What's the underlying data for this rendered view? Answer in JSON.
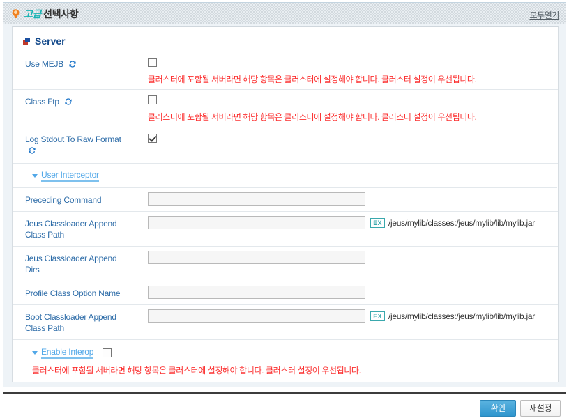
{
  "header": {
    "icon": "bulb-icon",
    "title_accent": "고급",
    "title_main": "선택사항",
    "open_all_label": "모두열기"
  },
  "section": {
    "icon": "blue-red-square-icon",
    "title": "Server"
  },
  "warnings": {
    "cluster_notice": "클러스터에 포함될 서버라면 해당 항목은 클러스터에 설정해야 합니다. 클러스터 설정이 우선됩니다."
  },
  "checkbox_rows": [
    {
      "label": "Use MEJB",
      "has_sync_icon": true,
      "checked": false,
      "warning": "클러스터에 포함될 서버라면 해당 항목은 클러스터에 설정해야 합니다. 클러스터 설정이 우선됩니다."
    },
    {
      "label": "Class Ftp",
      "has_sync_icon": true,
      "checked": false,
      "warning": "클러스터에 포함될 서버라면 해당 항목은 클러스터에 설정해야 합니다. 클러스터 설정이 우선됩니다."
    },
    {
      "label": "Log Stdout To Raw Format",
      "has_sync_icon": true,
      "checked": true,
      "warning": ""
    }
  ],
  "user_interceptor": {
    "toggle_label": "User Interceptor",
    "expanded": true,
    "fields": [
      {
        "label": "Preceding Command",
        "value": "",
        "placeholder": "",
        "example_badge": "",
        "example_text": ""
      },
      {
        "label": "Jeus Classloader Append Class Path",
        "value": "",
        "placeholder": "",
        "example_badge": "EX",
        "example_text": "/jeus/mylib/classes:/jeus/mylib/lib/mylib.jar"
      },
      {
        "label": "Jeus Classloader Append Dirs",
        "value": "",
        "placeholder": "",
        "example_badge": "",
        "example_text": ""
      },
      {
        "label": "Profile Class Option Name",
        "value": "",
        "placeholder": "",
        "example_badge": "",
        "example_text": ""
      },
      {
        "label": "Boot Classloader Append Class Path",
        "value": "",
        "placeholder": "",
        "example_badge": "EX",
        "example_text": "/jeus/mylib/classes:/jeus/mylib/lib/mylib.jar"
      }
    ]
  },
  "enable_interop": {
    "toggle_label": "Enable Interop",
    "checked": false,
    "warning": "클러스터에 포함될 서버라면 해당 항목은 클러스터에 설정해야 합니다. 클러스터 설정이 우선됩니다."
  },
  "footer": {
    "confirm_label": "확인",
    "reset_label": "재설정"
  },
  "colors": {
    "accent_teal": "#18b3b3",
    "label_blue": "#2d6ca8",
    "section_blue": "#154b8c",
    "warning_red": "#fb2f2f",
    "link_blue": "#52a8e8",
    "primary_button": "#2e95cd",
    "ex_badge": "#3aa8ad"
  }
}
